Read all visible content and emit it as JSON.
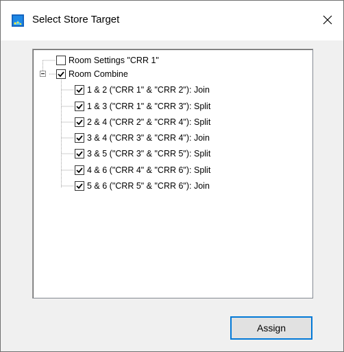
{
  "window": {
    "title": "Select Store Target",
    "close_icon": "close-icon",
    "app_icon": "app-icon"
  },
  "tree": {
    "items": [
      {
        "label": "Room Settings \"CRR 1\"",
        "checked": false,
        "level": 0
      },
      {
        "label": "Room Combine",
        "checked": true,
        "level": 0,
        "expanded": true
      },
      {
        "label": "1 & 2 (\"CRR 1\" & \"CRR 2\"): Join",
        "checked": true,
        "level": 1
      },
      {
        "label": "1 & 3 (\"CRR 1\" & \"CRR 3\"): Split",
        "checked": true,
        "level": 1
      },
      {
        "label": "2 & 4 (\"CRR 2\" & \"CRR 4\"): Split",
        "checked": true,
        "level": 1
      },
      {
        "label": "3 & 4 (\"CRR 3\" & \"CRR 4\"): Join",
        "checked": true,
        "level": 1
      },
      {
        "label": "3 & 5 (\"CRR 3\" & \"CRR 5\"): Split",
        "checked": true,
        "level": 1
      },
      {
        "label": "4 & 6 (\"CRR 4\" & \"CRR 6\"): Split",
        "checked": true,
        "level": 1
      },
      {
        "label": "5 & 6 (\"CRR 5\" & \"CRR 6\"): Join",
        "checked": true,
        "level": 1
      }
    ]
  },
  "footer": {
    "assign_label": "Assign"
  }
}
